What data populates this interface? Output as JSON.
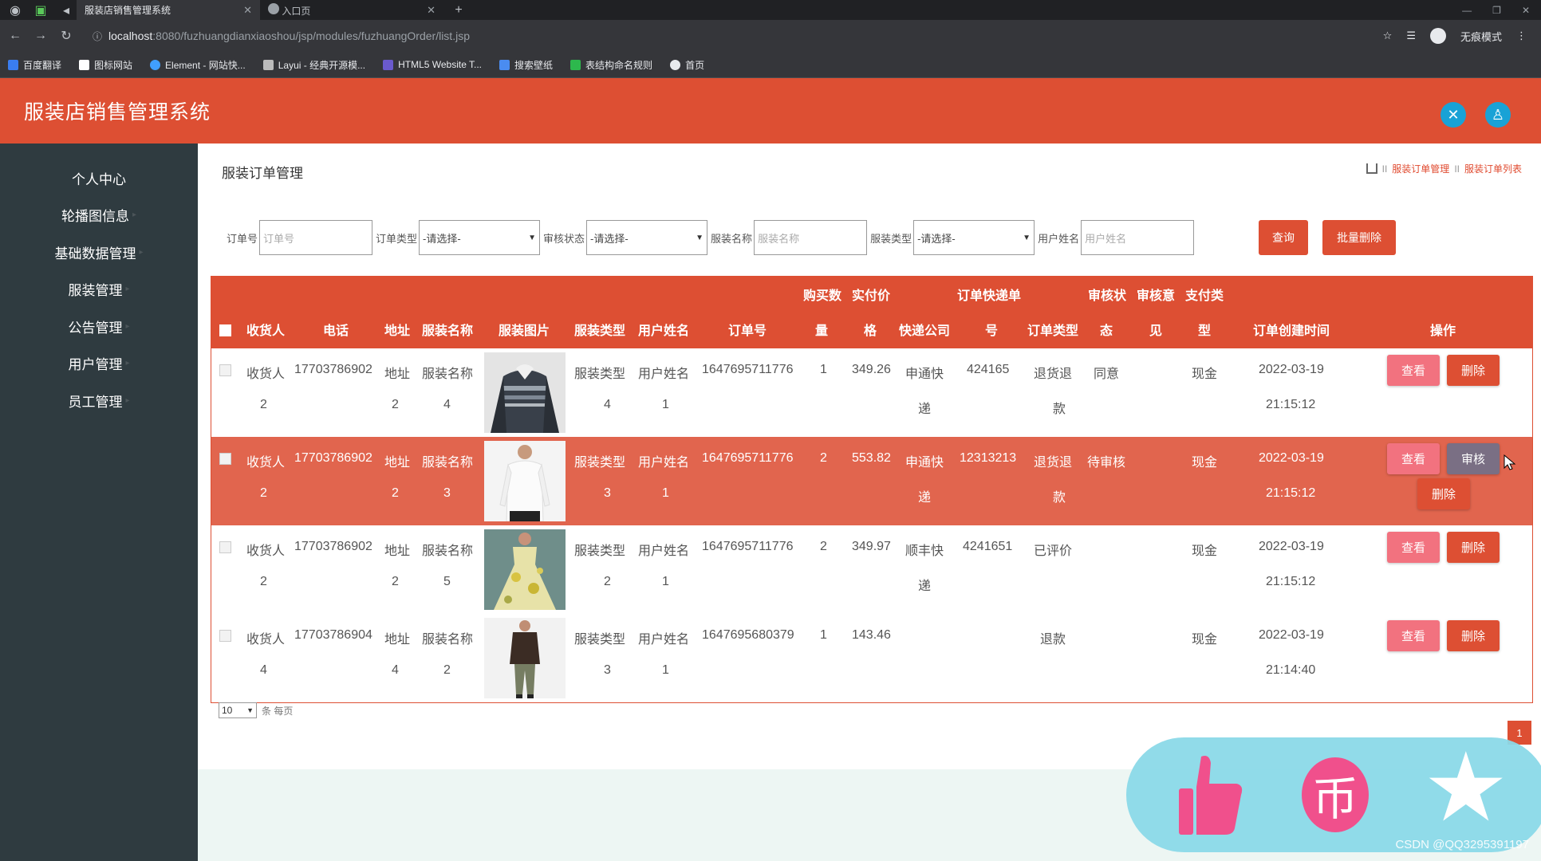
{
  "browser": {
    "tabs": [
      {
        "title": "服装店销售管理系统",
        "active": true
      },
      {
        "title": "入口页",
        "active": false
      }
    ],
    "url_host": "localhost",
    "url_path": ":8080/fuzhuangdianxiaoshou/jsp/modules/fuzhuangOrder/list.jsp",
    "profile_label": "无痕模式",
    "bookmarks": [
      "百度翻译",
      "图标网站",
      "Element - 网站快...",
      "Layui - 经典开源模...",
      "HTML5 Website T...",
      "搜索壁纸",
      "表结构命名规则",
      "首页"
    ]
  },
  "app": {
    "title": "服装店销售管理系统"
  },
  "sidebar": {
    "items": [
      "个人中心",
      "轮播图信息",
      "基础数据管理",
      "服装管理",
      "公告管理",
      "用户管理",
      "员工管理"
    ]
  },
  "page": {
    "title": "服装订单管理",
    "breadcrumb": [
      "服装订单管理",
      "服装订单列表"
    ]
  },
  "filters": {
    "order_no_label": "订单号",
    "order_no_placeholder": "订单号",
    "order_type_label": "订单类型",
    "order_type_value": "-请选择-",
    "audit_label": "审核状态",
    "audit_value": "-请选择-",
    "name_label": "服装名称",
    "name_placeholder": "服装名称",
    "cloth_type_label": "服装类型",
    "cloth_type_value": "-请选择-",
    "user_label": "用户姓名",
    "user_placeholder": "用户姓名",
    "search_button": "查询",
    "batch_delete_button": "批量删除"
  },
  "table": {
    "headers": {
      "receiver": "收货人",
      "phone": "电话",
      "address": "地址",
      "cloth_name": "服装名称",
      "cloth_image": "服装图片",
      "cloth_type": "服装类型",
      "user_name": "用户姓名",
      "order_no": "订单号",
      "qty_1": "购买数",
      "qty_2": "量",
      "price_1": "实付价",
      "price_2": "格",
      "express": "快递公司",
      "tracking_1": "订单快递单",
      "tracking_2": "号",
      "order_type": "订单类型",
      "audit_status_1": "审核状",
      "audit_status_2": "态",
      "audit_opinion_1": "审核意",
      "audit_opinion_2": "见",
      "pay_type_1": "支付类",
      "pay_type_2": "型",
      "created": "订单创建时间",
      "ops": "操作"
    },
    "rows": [
      {
        "receiver_1": "收货人",
        "receiver_2": "2",
        "phone": "17703786902",
        "addr_1": "地址",
        "addr_2": "2",
        "name_1": "服装名称",
        "name_2": "4",
        "type_1": "服装类型",
        "type_2": "4",
        "user_1": "用户姓名",
        "user_2": "1",
        "order_no": "1647695711776",
        "qty": "1",
        "price": "349.26",
        "express_1": "申通快",
        "express_2": "递",
        "tracking": "424165",
        "order_type_1": "退货退",
        "order_type_2": "款",
        "audit_status": "同意",
        "pay": "现金",
        "date": "2022-03-19",
        "time": "21:15:12"
      },
      {
        "receiver_1": "收货人",
        "receiver_2": "2",
        "phone": "17703786902",
        "addr_1": "地址",
        "addr_2": "2",
        "name_1": "服装名称",
        "name_2": "3",
        "type_1": "服装类型",
        "type_2": "3",
        "user_1": "用户姓名",
        "user_2": "1",
        "order_no": "1647695711776",
        "qty": "2",
        "price": "553.82",
        "express_1": "申通快",
        "express_2": "递",
        "tracking": "12313213",
        "order_type_1": "退货退",
        "order_type_2": "款",
        "audit_status": "待审核",
        "pay": "现金",
        "date": "2022-03-19",
        "time": "21:15:12"
      },
      {
        "receiver_1": "收货人",
        "receiver_2": "2",
        "phone": "17703786902",
        "addr_1": "地址",
        "addr_2": "2",
        "name_1": "服装名称",
        "name_2": "5",
        "type_1": "服装类型",
        "type_2": "2",
        "user_1": "用户姓名",
        "user_2": "1",
        "order_no": "1647695711776",
        "qty": "2",
        "price": "349.97",
        "express_1": "顺丰快",
        "express_2": "递",
        "tracking": "4241651",
        "order_type_1": "已评价",
        "order_type_2": "",
        "audit_status": "",
        "pay": "现金",
        "date": "2022-03-19",
        "time": "21:15:12"
      },
      {
        "receiver_1": "收货人",
        "receiver_2": "4",
        "phone": "17703786904",
        "addr_1": "地址",
        "addr_2": "4",
        "name_1": "服装名称",
        "name_2": "2",
        "type_1": "服装类型",
        "type_2": "3",
        "user_1": "用户姓名",
        "user_2": "1",
        "order_no": "1647695680379",
        "qty": "1",
        "price": "143.46",
        "express_1": "",
        "express_2": "",
        "tracking": "",
        "order_type_1": "退款",
        "order_type_2": "",
        "audit_status": "",
        "pay": "现金",
        "date": "2022-03-19",
        "time": "21:14:40"
      }
    ],
    "view_button": "查看",
    "delete_button": "删除",
    "audit_button": "审核"
  },
  "pager": {
    "page_size": "10",
    "suffix": "条 每页",
    "current_page": "1"
  },
  "watermark": "CSDN @QQ3295391197"
}
